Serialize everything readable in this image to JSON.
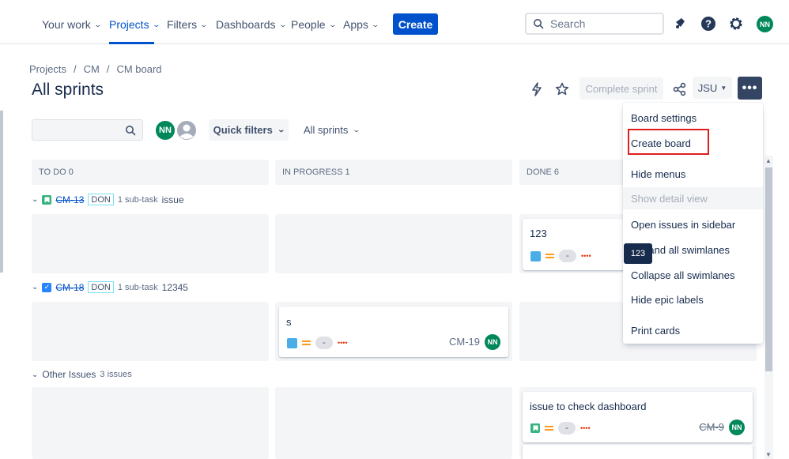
{
  "nav": {
    "items": [
      {
        "label": "Your work"
      },
      {
        "label": "Projects"
      },
      {
        "label": "Filters"
      },
      {
        "label": "Dashboards"
      },
      {
        "label": "People"
      },
      {
        "label": "Apps"
      }
    ],
    "create_label": "Create",
    "search_placeholder": "Search",
    "user_initials": "NN"
  },
  "breadcrumb": [
    "Projects",
    "/",
    "CM",
    "/",
    "CM board"
  ],
  "page_title": "All sprints",
  "header_actions": {
    "complete_sprint": "Complete sprint",
    "jsu": "JSU",
    "more": "•••"
  },
  "filters": {
    "avatar_initials": "NN",
    "quick_filters": "Quick filters",
    "sprint_select": "All sprints"
  },
  "columns": [
    {
      "label": "TO DO 0"
    },
    {
      "label": "IN PROGRESS 1"
    },
    {
      "label": "DONE 6"
    }
  ],
  "swimlanes": [
    {
      "key": "CM-13",
      "status": "DON",
      "subtasks": "1 sub-task",
      "summary": "issue"
    },
    {
      "key": "CM-18",
      "status": "DON",
      "subtasks": "1 sub-task",
      "summary": "12345"
    },
    {
      "label": "Other Issues",
      "count": "3 issues"
    }
  ],
  "cards": [
    {
      "title": "123",
      "pill": "-",
      "dots": "••••"
    },
    {
      "title": "s",
      "pill": "-",
      "dots": "••••",
      "key": "CM-19",
      "avatar": "NN"
    },
    {
      "title": "issue to check dashboard",
      "pill": "-",
      "dots": "••••",
      "key": "CM-9",
      "avatar": "NN"
    }
  ],
  "menu": [
    {
      "label": "Board settings"
    },
    {
      "label": "Create board"
    },
    {
      "label": "Hide menus"
    },
    {
      "label": "Show detail view"
    },
    {
      "label": "Open issues in sidebar"
    },
    {
      "label": "Expand all swimlanes"
    },
    {
      "label": "Collapse all swimlanes"
    },
    {
      "label": "Hide epic labels"
    },
    {
      "label": "Print cards"
    }
  ],
  "tooltip": "123",
  "colors": {
    "brand": "#0052cc",
    "avatar": "#00875a",
    "highlight": "#e01e1e"
  }
}
